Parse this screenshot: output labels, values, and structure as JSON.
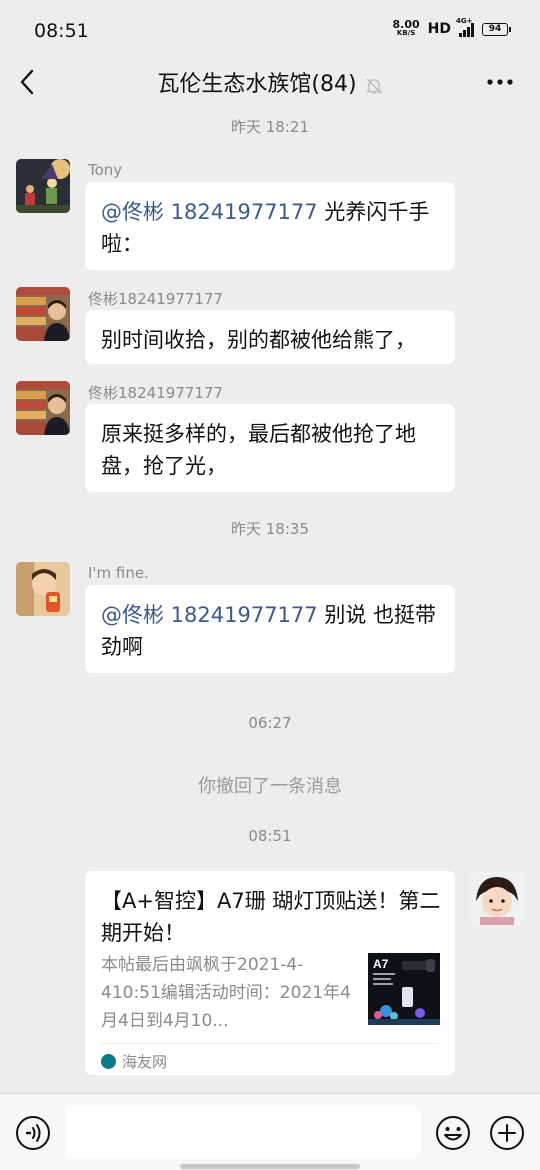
{
  "status": {
    "time": "08:51",
    "net_speed": "8.00",
    "net_unit": "KB/S",
    "hd": "HD",
    "signal": "4G+",
    "battery": "94"
  },
  "header": {
    "title": "瓦伦生态水族馆(84)"
  },
  "messages": [
    {
      "sender": "Tony",
      "mention": "@佟彬 18241977177",
      "text": " 光养闪千手啦："
    },
    {
      "sender": "佟彬18241977177",
      "text": "别时间收拾，别的都被他给熊了，"
    },
    {
      "sender": "佟彬18241977177",
      "text": "原来挺多样的，最后都被他抢了地盘，抢了光，"
    },
    {
      "sender": "I'm fine.",
      "mention": "@佟彬 18241977177",
      "text": " 别说 也挺带劲啊"
    }
  ],
  "timestamps": [
    "昨天 18:21",
    "昨天 18:35",
    "06:27",
    "08:51"
  ],
  "recall_notice": "你撤回了一条消息",
  "link_card": {
    "title": "【A+智控】A7珊 瑚灯顶贴送！第二期开始！",
    "description": "本帖最后由飒枫于2021-4-410:51编辑活动时间：2021年4月4日到4月10...",
    "thumb_text": "A7",
    "source": "海友网"
  },
  "icons": {
    "back": "back-arrow-icon",
    "mute": "bell-off-icon",
    "more": "more-icon",
    "voice": "voice-icon",
    "emoji": "emoji-icon",
    "plus": "plus-icon"
  },
  "colors": {
    "background": "#ededed",
    "bubble": "#ffffff",
    "mention": "#3b5a8a",
    "meta_text": "#8a8a8a"
  }
}
